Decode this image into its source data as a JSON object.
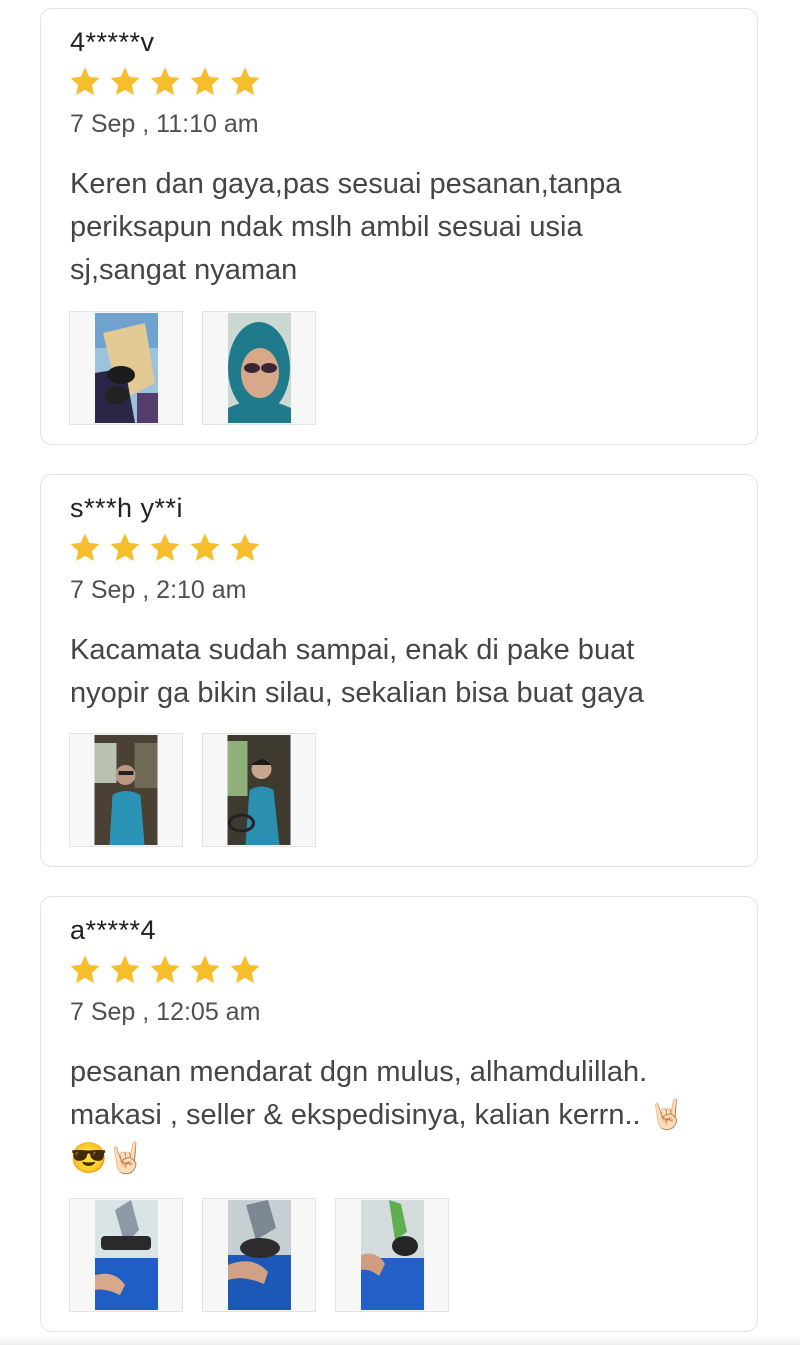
{
  "reviews": [
    {
      "name": "4*****v",
      "rating": 5,
      "date": "7 Sep , 11:10 am",
      "lines": [
        "Keren dan gaya,pas sesuai pesanan,tanpa",
        "periksapun ndak mslh ambil sesuai usia",
        "sj,sangat nyaman"
      ]
    },
    {
      "name": "s***h y**i",
      "rating": 5,
      "date": "7 Sep , 2:10 am",
      "lines": [
        "Kacamata sudah sampai, enak di pake buat",
        "nyopir ga bikin silau, sekalian bisa buat gaya"
      ]
    },
    {
      "name": "a*****4",
      "rating": 5,
      "date": "7 Sep , 12:05 am",
      "lines": [
        "pesanan mendarat dgn mulus, alhamdulillah.",
        "makasi , seller & ekspedisinya, kalian kerrn.. 🤘🏻",
        "😎🤘🏻"
      ]
    }
  ],
  "colors": {
    "star": "#F6BE2C",
    "card_border": "#E2E2E2",
    "text": "#454545"
  }
}
